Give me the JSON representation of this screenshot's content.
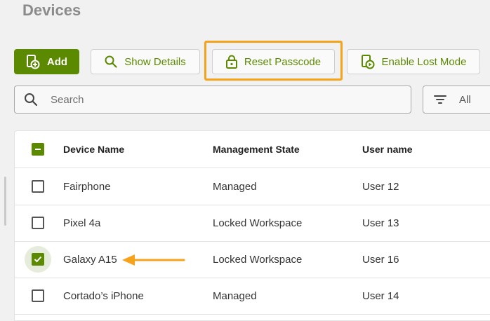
{
  "page": {
    "title": "Devices"
  },
  "toolbar": {
    "add_label": "Add",
    "show_details_label": "Show Details",
    "reset_passcode_label": "Reset Passcode",
    "enable_lost_mode_label": "Enable Lost Mode"
  },
  "search": {
    "placeholder": "Search",
    "value": ""
  },
  "filter": {
    "label": "All"
  },
  "table": {
    "columns": [
      "Device Name",
      "Management State",
      "User name"
    ],
    "rows": [
      {
        "name": "Fairphone",
        "state": "Managed",
        "user": "User 12",
        "selected": false
      },
      {
        "name": "Pixel 4a",
        "state": "Locked Workspace",
        "user": "User 13",
        "selected": false
      },
      {
        "name": "Galaxy A15",
        "state": "Locked Workspace",
        "user": "User 16",
        "selected": true
      },
      {
        "name": "Cortado’s iPhone",
        "state": "Managed",
        "user": "User 14",
        "selected": false
      }
    ]
  },
  "colors": {
    "accent": "#5b8a00",
    "highlight": "#f7a21b",
    "title": "#8b8b8b"
  },
  "icons": [
    "add-device-icon",
    "search-icon",
    "lock-icon",
    "lost-mode-icon",
    "filter-icon",
    "checkbox-icon",
    "arrow-left-icon"
  ]
}
